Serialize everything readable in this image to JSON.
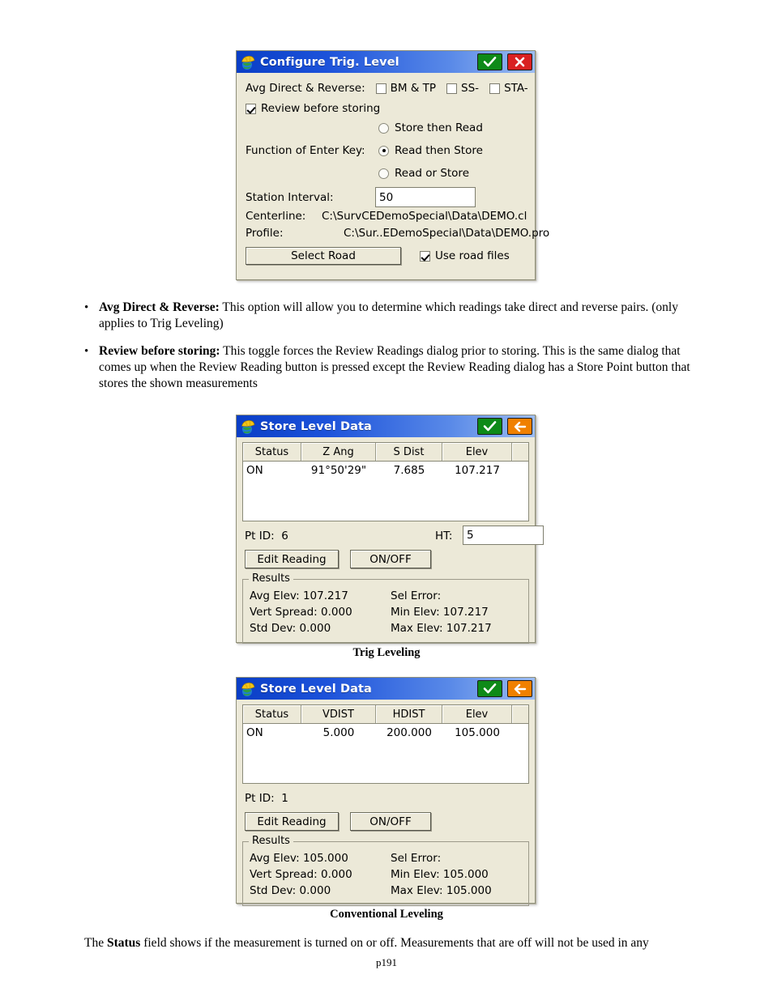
{
  "dialog_configure": {
    "title": "Configure Trig. Level",
    "icon": "surveyor-hardhat-globe-icon",
    "ok_label": "OK",
    "close_label": "Close",
    "avg_direct_reverse_label": "Avg Direct & Reverse:",
    "avg_options": [
      {
        "label": "BM & TP",
        "checked": false
      },
      {
        "label": "SS-",
        "checked": false
      },
      {
        "label": "STA-",
        "checked": false
      }
    ],
    "review_before_storing": {
      "label": "Review before storing",
      "checked": true
    },
    "enter_key_label": "Function of Enter Key:",
    "enter_key_options": [
      {
        "label": "Store then Read",
        "selected": false
      },
      {
        "label": "Read then Store",
        "selected": true
      },
      {
        "label": "Read or Store",
        "selected": false
      }
    ],
    "station_interval_label": "Station Interval:",
    "station_interval_value": "50",
    "centerline_label": "Centerline:",
    "centerline_value": "C:\\SurvCEDemoSpecial\\Data\\DEMO.cl",
    "profile_label": "Profile:",
    "profile_value": "C:\\Sur..EDemoSpecial\\Data\\DEMO.pro",
    "select_road_label": "Select Road",
    "use_road_files": {
      "label": "Use road files",
      "checked": true
    }
  },
  "bullets": [
    {
      "marker": "•",
      "term": "Avg Direct & Reverse:",
      "text": " This option will allow you to determine which readings take direct and reverse pairs. (only applies to Trig Leveling)"
    },
    {
      "marker": "•",
      "term": "Review before storing:",
      "text": " This toggle forces the Review Readings dialog prior to storing.  This is the same dialog that comes up when the Review Reading button is pressed except the Review Reading dialog has a Store Point button that stores the shown measurements"
    }
  ],
  "dialog_store_trig": {
    "title": "Store Level Data",
    "icon": "surveyor-hardhat-globe-icon",
    "ok_label": "OK",
    "back_label": "Back",
    "columns": [
      "Status",
      "Z Ang",
      "S Dist",
      "Elev",
      ""
    ],
    "rows": [
      [
        "ON",
        "91°50'29\"",
        "7.685",
        "107.217",
        ""
      ]
    ],
    "pt_id_label": "Pt ID:",
    "pt_id_value": "6",
    "ht_label": "HT:",
    "ht_value": "5",
    "edit_reading_label": "Edit Reading",
    "onoff_label": "ON/OFF",
    "results_legend": "Results",
    "results_left": [
      "Avg Elev: 107.217",
      "Vert Spread: 0.000",
      "Std Dev: 0.000"
    ],
    "results_right": [
      "Sel Error:",
      "Min Elev: 107.217",
      "Max Elev: 107.217"
    ]
  },
  "caption_trig": "Trig Leveling",
  "dialog_store_conv": {
    "title": "Store Level Data",
    "icon": "surveyor-hardhat-globe-icon",
    "ok_label": "OK",
    "back_label": "Back",
    "columns": [
      "Status",
      "VDIST",
      "HDIST",
      "Elev",
      ""
    ],
    "rows": [
      [
        "ON",
        "5.000",
        "200.000",
        "105.000",
        ""
      ]
    ],
    "pt_id_label": "Pt ID:",
    "pt_id_value": "1",
    "edit_reading_label": "Edit Reading",
    "onoff_label": "ON/OFF",
    "results_legend": "Results",
    "results_left": [
      "Avg Elev: 105.000",
      "Vert Spread: 0.000",
      "Std Dev: 0.000"
    ],
    "results_right": [
      "Sel Error:",
      "Min Elev: 105.000",
      "Max Elev: 105.000"
    ]
  },
  "caption_conv": "Conventional Leveling",
  "closing_paragraph": {
    "lead": "The ",
    "term": "Status",
    "rest": " field shows if the measurement is turned on or off.  Measurements that are off will not be used in any"
  },
  "page_number": "p191",
  "colors": {
    "titlebar_blue_dark": "#0a3ec6",
    "titlebar_blue_light": "#9dbdf2",
    "ok_green": "#0e8a18",
    "close_red": "#d92121",
    "back_orange": "#f08000",
    "dialog_face": "#ece9d8"
  }
}
